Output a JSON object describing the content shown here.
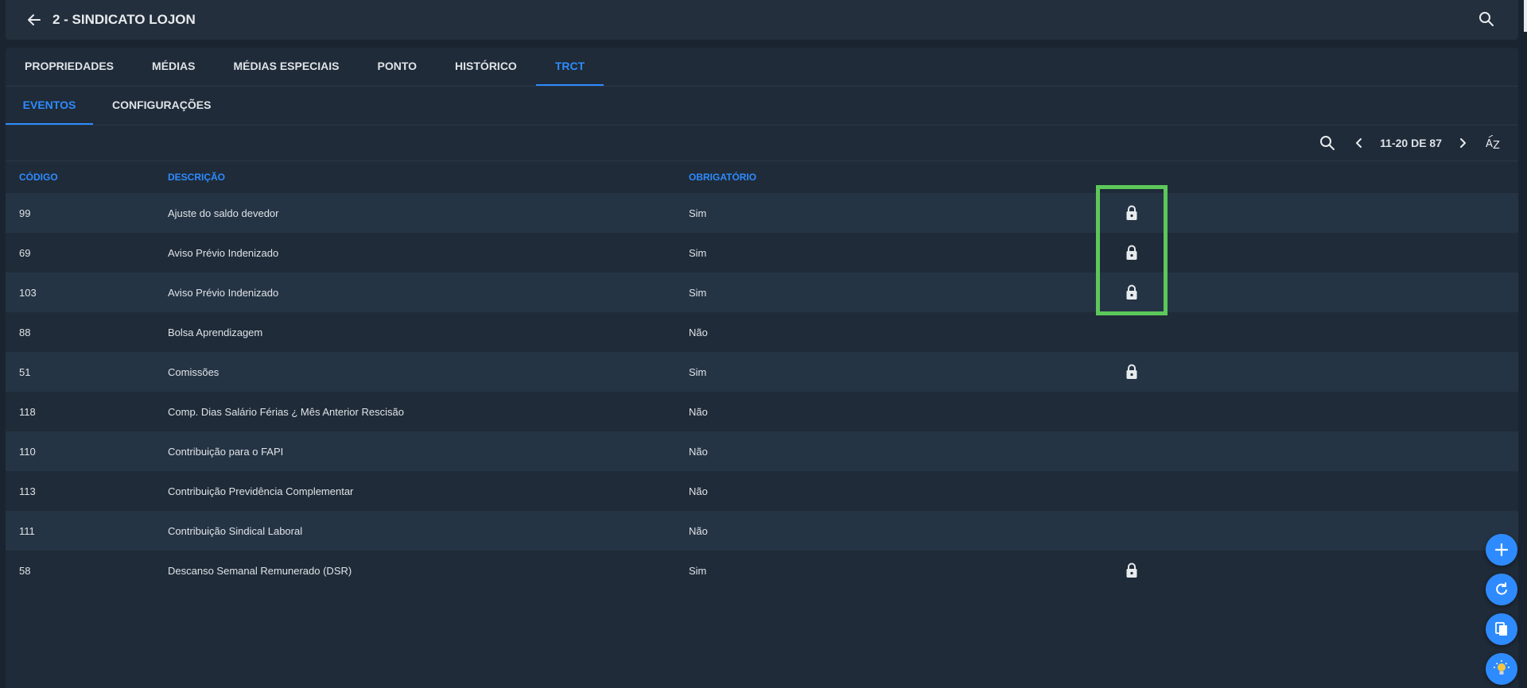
{
  "header": {
    "title": "2 - SINDICATO LOJON"
  },
  "tabs": [
    {
      "label": "PROPRIEDADES",
      "active": false
    },
    {
      "label": "MÉDIAS",
      "active": false
    },
    {
      "label": "MÉDIAS ESPECIAIS",
      "active": false
    },
    {
      "label": "PONTO",
      "active": false
    },
    {
      "label": "HISTÓRICO",
      "active": false
    },
    {
      "label": "TRCT",
      "active": true
    }
  ],
  "subtabs": [
    {
      "label": "EVENTOS",
      "active": true
    },
    {
      "label": "CONFIGURAÇÕES",
      "active": false
    }
  ],
  "toolbar": {
    "pager": "11-20 DE 87",
    "sort_icon": "sort-az-icon"
  },
  "table": {
    "headers": [
      "CÓDIGO",
      "DESCRIÇÃO",
      "OBRIGATÓRIO"
    ],
    "rows": [
      {
        "code": "99",
        "desc": "Ajuste do saldo devedor",
        "req": "Sim",
        "locked": true
      },
      {
        "code": "69",
        "desc": "Aviso Prévio Indenizado",
        "req": "Sim",
        "locked": true
      },
      {
        "code": "103",
        "desc": "Aviso Prévio Indenizado",
        "req": "Sim",
        "locked": true
      },
      {
        "code": "88",
        "desc": "Bolsa Aprendizagem",
        "req": "Não",
        "locked": false
      },
      {
        "code": "51",
        "desc": "Comissões",
        "req": "Sim",
        "locked": true
      },
      {
        "code": "118",
        "desc": "Comp. Dias Salário Férias ¿ Mês Anterior Rescisão",
        "req": "Não",
        "locked": false
      },
      {
        "code": "110",
        "desc": "Contribuição para o FAPI",
        "req": "Não",
        "locked": false
      },
      {
        "code": "113",
        "desc": "Contribuição Previdência Complementar",
        "req": "Não",
        "locked": false
      },
      {
        "code": "111",
        "desc": "Contribuição Sindical Laboral",
        "req": "Não",
        "locked": false
      },
      {
        "code": "58",
        "desc": "Descanso Semanal Remunerado (DSR)",
        "req": "Sim",
        "locked": true
      }
    ]
  },
  "colors": {
    "accent": "#2e8bff",
    "highlight": "#5cc85a"
  },
  "fabs": [
    "add-icon",
    "refresh-icon",
    "copy-icon",
    "lightbulb-icon"
  ]
}
